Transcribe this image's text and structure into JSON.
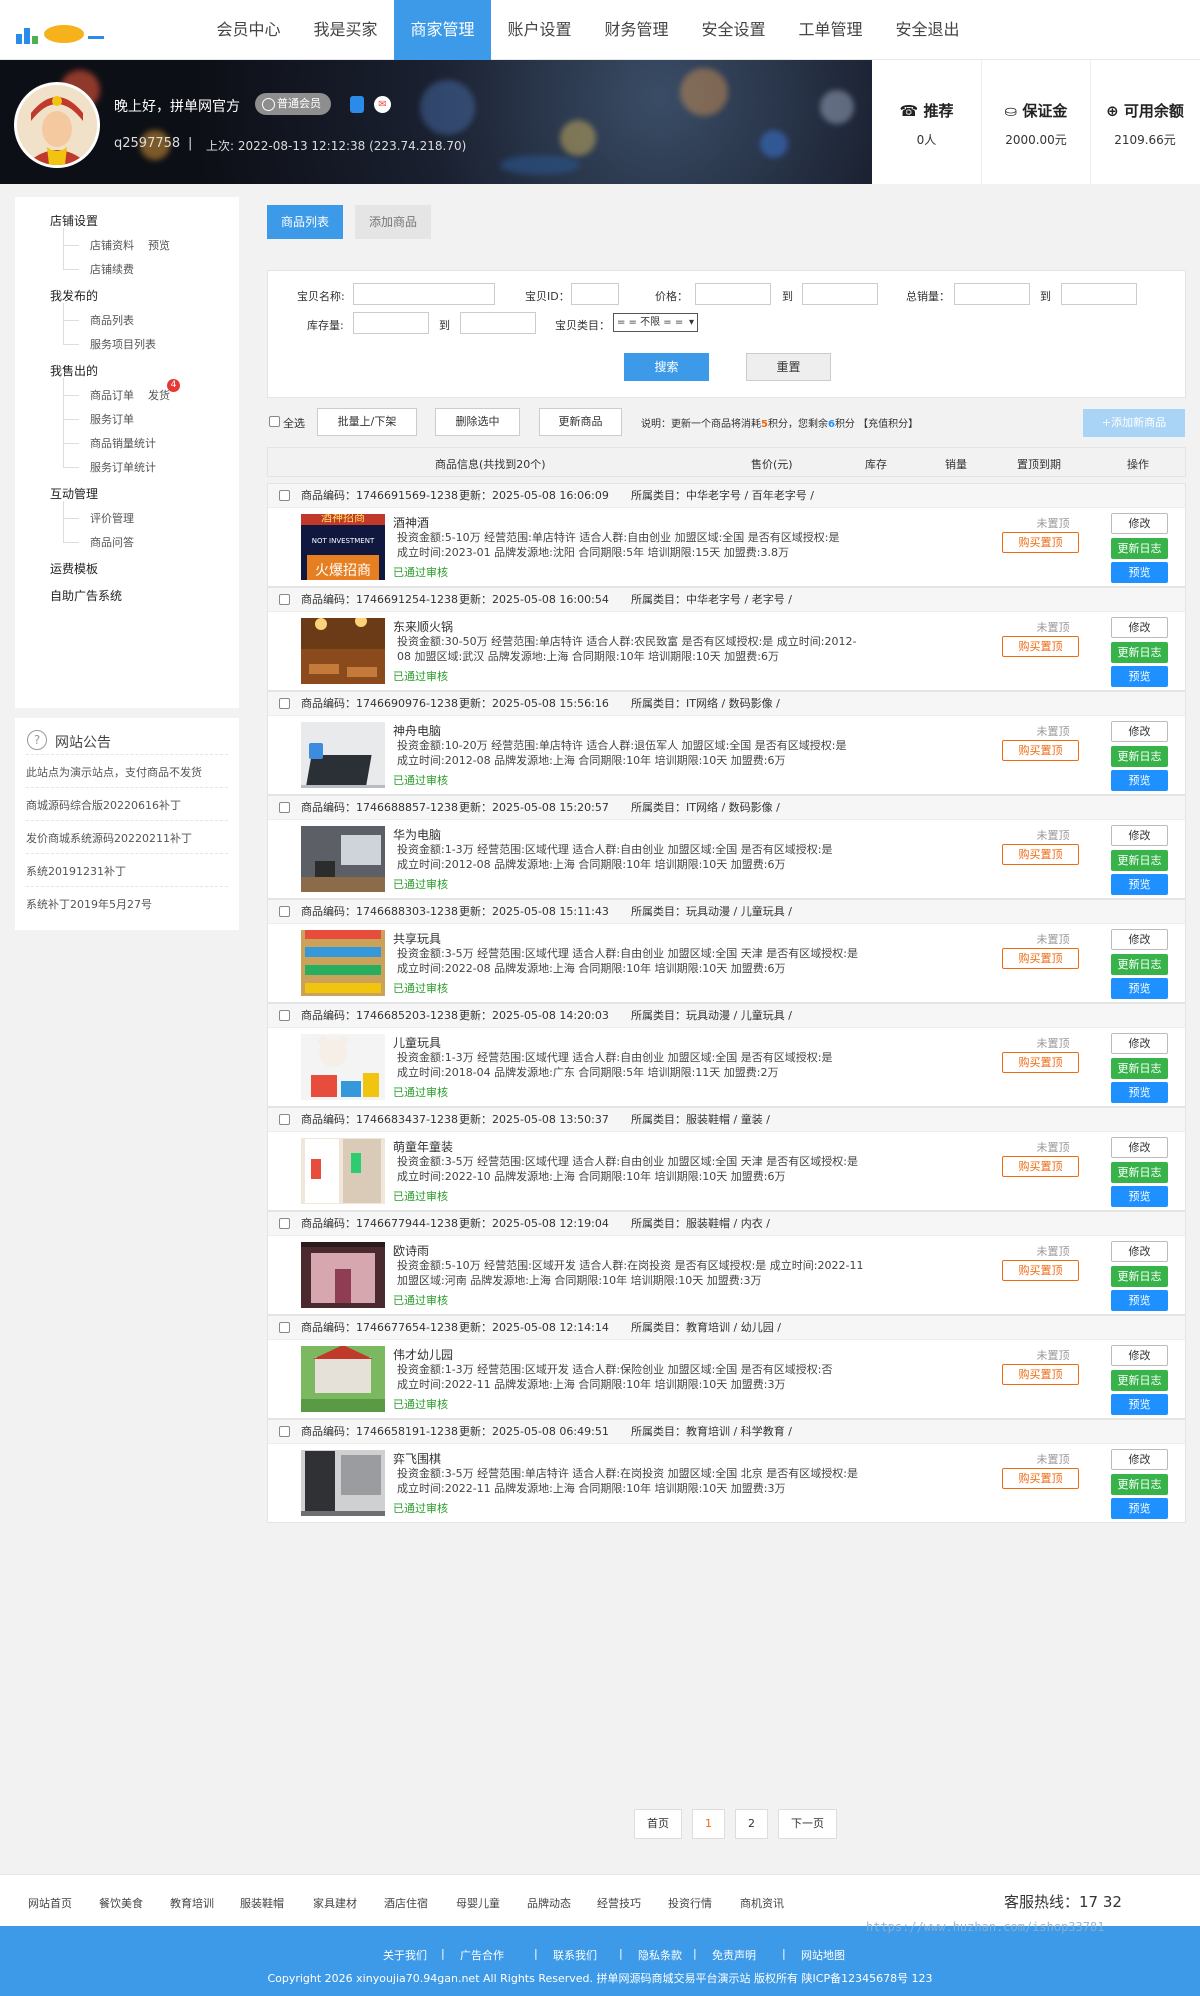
{
  "nav": [
    "会员中心",
    "我是买家",
    "商家管理",
    "账户设置",
    "财务管理",
    "安全设置",
    "工单管理",
    "安全退出"
  ],
  "nav_active": 2,
  "user": {
    "greeting": "晚上好，拼单网官方",
    "grade": "普通会员",
    "uid": "q2597758",
    "sep": "|",
    "last_login": "上次: 2022-08-13 12:12:38 (223.74.218.70)",
    "mail_glyph": "✉"
  },
  "stats": [
    {
      "label": "☎ 推荐",
      "value": "0人"
    },
    {
      "label": "⛀ 保证金",
      "value": "2000.00元"
    },
    {
      "label": "⊕ 可用余额",
      "value": "2109.66元"
    }
  ],
  "sidebar": {
    "groups": [
      {
        "title": "店铺设置",
        "items": [
          "店铺资料",
          "店铺续费"
        ],
        "extra": {
          "index": 0,
          "text": "预览"
        }
      },
      {
        "title": "我发布的",
        "items": [
          "商品列表",
          "服务项目列表"
        ]
      },
      {
        "title": "我售出的",
        "items": [
          "商品订单",
          "服务订单",
          "商品销量统计",
          "服务订单统计"
        ],
        "extra": {
          "index": 0,
          "text": "发货",
          "badge": "4"
        }
      },
      {
        "title": "互动管理",
        "items": [
          "评价管理",
          "商品问答"
        ]
      },
      {
        "title": "运费模板",
        "items": []
      },
      {
        "title": "自助广告系统",
        "items": []
      }
    ]
  },
  "notice": {
    "title": "网站公告",
    "icon": "?",
    "items": [
      "此站点为演示站点，支付商品不发货",
      "商城源码综合版20220616补丁",
      "发价商城系统源码20220211补丁",
      "系统20191231补丁",
      "系统补丁2019年5月27号"
    ]
  },
  "tabs": [
    "商品列表",
    "添加商品"
  ],
  "filter": {
    "name_label": "宝贝名称:",
    "id_label": "宝贝ID：",
    "price_label": "价格：",
    "to": "到",
    "sales_label": "总销量：",
    "stock_label": "库存量:",
    "cat_label": "宝贝类目：",
    "cat_value": "= = 不限 = =",
    "search": "搜索",
    "reset": "重置"
  },
  "bulk": {
    "all": "全选",
    "toggle": "批量上/下架",
    "delete": "删除选中",
    "refresh": "更新商品",
    "note_pre": "说明：更新一个商品将消耗",
    "note_n1": "5",
    "note_mid": "积分，您剩余",
    "note_n2": "6",
    "note_post": "积分 【充值积分】",
    "add": "+添加新商品"
  },
  "table_header": {
    "info": "商品信息(共找到20个)",
    "price": "售价(元)",
    "stock": "库存",
    "sales": "销量",
    "top": "置顶到期",
    "ops": "操作"
  },
  "labels": {
    "code": "商品编码：",
    "upd": "更新：",
    "cat": "所属类目：",
    "audit": "已通过审核",
    "not_top": "未置顶",
    "buy_top": "购买置顶",
    "edit": "修改",
    "log": "更新日志",
    "preview": "预览"
  },
  "items": [
    {
      "code": "1746691569-1238",
      "updated": "2025-05-08 16:06:09",
      "category": "中华老字号 / 百年老字号 /",
      "name": "酒神酒",
      "details": "投资金额:5-10万   经营范围:单店特许   适合人群:自由创业   加盟区域:全国   是否有区域授权:是\n      成立时间:2023-01   品牌发源地:沈阳   合同期限:5年   培训期限:15天   加盟费:3.8万",
      "thumb": "poster"
    },
    {
      "code": "1746691254-1238",
      "updated": "2025-05-08 16:00:54",
      "category": "中华老字号 / 老字号 /",
      "name": "东来顺火锅",
      "details": "投资金额:30-50万   经营范围:单店特许   适合人群:农民致富   是否有区域授权:是   成立时间:2012-\n08   加盟区域:武汉   品牌发源地:上海   合同期限:10年   培训期限:10天   加盟费:6万",
      "thumb": "restaurant"
    },
    {
      "code": "1746690976-1238",
      "updated": "2025-05-08 15:56:16",
      "category": "IT网络 / 数码影像 /",
      "name": "神舟电脑",
      "details": "投资金额:10-20万   经营范围:单店特许   适合人群:退伍军人   加盟区域:全国   是否有区域授权:是\n      成立时间:2012-08   品牌发源地:上海   合同期限:10年   培训期限:10天   加盟费:6万",
      "thumb": "laptop"
    },
    {
      "code": "1746688857-1238",
      "updated": "2025-05-08 15:20:57",
      "category": "IT网络 / 数码影像 /",
      "name": "华为电脑",
      "details": "投资金额:1-3万   经营范围:区域代理   适合人群:自由创业   加盟区域:全国   是否有区域授权:是\n      成立时间:2012-08   品牌发源地:上海   合同期限:10年   培训期限:10天   加盟费:6万",
      "thumb": "desk"
    },
    {
      "code": "1746688303-1238",
      "updated": "2025-05-08 15:11:43",
      "category": "玩具动漫 / 儿童玩具 /",
      "name": "共享玩具",
      "details": "投资金额:3-5万   经营范围:区域代理   适合人群:自由创业   加盟区域:全国 天津   是否有区域授权:是\n      成立时间:2022-08   品牌发源地:上海   合同期限:10年   培训期限:10天   加盟费:6万",
      "thumb": "toyshop"
    },
    {
      "code": "1746685203-1238",
      "updated": "2025-05-08 14:20:03",
      "category": "玩具动漫 / 儿童玩具 /",
      "name": "儿童玩具",
      "details": "投资金额:1-3万   经营范围:区域代理   适合人群:自由创业   加盟区域:全国   是否有区域授权:是\n      成立时间:2018-04   品牌发源地:广东   合同期限:5年   培训期限:11天   加盟费:2万",
      "thumb": "toys"
    },
    {
      "code": "1746683437-1238",
      "updated": "2025-05-08 13:50:37",
      "category": "服装鞋帽 / 童装 /",
      "name": "萌童年童装",
      "details": "投资金额:3-5万   经营范围:区域代理   适合人群:自由创业   加盟区域:全国 天津   是否有区域授权:是\n      成立时间:2022-10   品牌发源地:上海   合同期限:10年   培训期限:10天   加盟费:6万",
      "thumb": "kidsstore"
    },
    {
      "code": "1746677944-1238",
      "updated": "2025-05-08 12:19:04",
      "category": "服装鞋帽 / 内衣 /",
      "name": "欧诗雨",
      "details": "投资金额:5-10万   经营范围:区域开发   适合人群:在岗投资   是否有区域授权:是   成立时间:2022-11\n      加盟区域:河南   品牌发源地:上海   合同期限:10年   培训期限:10天   加盟费:3万",
      "thumb": "storefront"
    },
    {
      "code": "1746677654-1238",
      "updated": "2025-05-08 12:14:14",
      "category": "教育培训 / 幼儿园 /",
      "name": "伟才幼儿园",
      "details": "投资金额:1-3万   经营范围:区域开发   适合人群:保险创业   加盟区域:全国   是否有区域授权:否\n      成立时间:2022-11   品牌发源地:上海   合同期限:10年   培训期限:10天   加盟费:3万",
      "thumb": "school"
    },
    {
      "code": "1746658191-1238",
      "updated": "2025-05-08 06:49:51",
      "category": "教育培训 / 科学教育 /",
      "name": "弈飞围棋",
      "details": "投资金额:3-5万   经营范围:单店特许   适合人群:在岗投资   加盟区域:全国 北京   是否有区域授权:是\n      成立时间:2022-11   品牌发源地:上海   合同期限:10年   培训期限:10天   加盟费:3万",
      "thumb": "room"
    }
  ],
  "pager": [
    "首页",
    "1",
    "2",
    "下一页"
  ],
  "pager_current": 1,
  "footer_nav": [
    "网站首页",
    "餐饮美食",
    "教育培训",
    "服装鞋帽",
    "家具建材",
    "酒店住宿",
    "母婴儿童",
    "品牌动态",
    "经营技巧",
    "投资行情",
    "商机资讯"
  ],
  "hotline": "客服热线：17        32",
  "copy_links": [
    "关于我们",
    "|",
    "广告合作",
    "|",
    "联系我们",
    "|",
    "隐私条款",
    "|",
    "免责声明",
    "|",
    "网站地图"
  ],
  "copyright": "Copyright 2026 xinyoujia70.94gan.net All Rights Reserved. 拼单网源码商城交易平台演示站   版权所有   陕ICP备12345678号 123",
  "watermark": "https://www.huzhan.com/ishop33781",
  "colors": {
    "accent": "#3d9ae8",
    "success": "#37b34a",
    "preview": "#1e90ff",
    "warn": "#f06a10"
  }
}
